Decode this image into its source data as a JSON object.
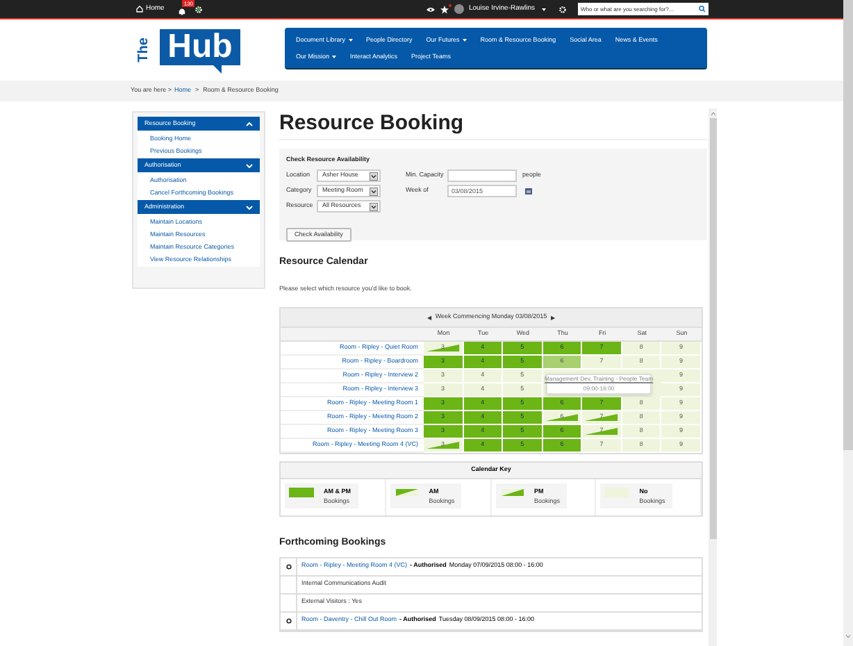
{
  "topbar": {
    "home": "Home",
    "notifications": "130",
    "user": "Louise Irvine-Rawlins",
    "search_placeholder": "Who or what are you searching for?..."
  },
  "logo": {
    "small": "The",
    "big": "Hub"
  },
  "nav": [
    {
      "label": "Document Library",
      "dropdown": true
    },
    {
      "label": "People Directory",
      "dropdown": false
    },
    {
      "label": "Our Futures",
      "dropdown": true
    },
    {
      "label": "Room & Resource Booking",
      "dropdown": false
    },
    {
      "label": "Social Area",
      "dropdown": false
    },
    {
      "label": "News & Events",
      "dropdown": false
    },
    {
      "label": "Our Mission",
      "dropdown": true
    },
    {
      "label": "Interact Analytics",
      "dropdown": false
    },
    {
      "label": "Project Teams",
      "dropdown": false
    }
  ],
  "breadcrumb": {
    "prefix": "You are here >",
    "home": "Home",
    "sep": ">",
    "current": "Room & Resource Booking"
  },
  "sidebar": [
    {
      "title": "Resource Booking",
      "expanded": true,
      "items": [
        "Booking Home",
        "Previous Bookings"
      ]
    },
    {
      "title": "Authorisation",
      "expanded": false,
      "items": [
        "Authorisation",
        "Cancel Forthcoming Bookings"
      ]
    },
    {
      "title": "Administration",
      "expanded": false,
      "items": [
        "Maintain Locations",
        "Maintain Resources",
        "Maintain Resource Categories",
        "View Resource Relationships"
      ]
    }
  ],
  "title": "Resource Booking",
  "form": {
    "heading": "Check Resource Availability",
    "selects": [
      {
        "label": "Location",
        "value": "Asher House"
      },
      {
        "label": "Category",
        "value": "Meeting Room"
      },
      {
        "label": "Resource",
        "value": "All Resources"
      }
    ],
    "capacity": {
      "label": "Min. Capacity",
      "unit": "people"
    },
    "week": {
      "label": "Week of",
      "value": "03/08/2015"
    },
    "button": "Check Availability"
  },
  "calendar": {
    "heading": "Resource Calendar",
    "intro": "Please select which resource you'd like to book.",
    "prev": "◀",
    "week": "Week Commencing Monday 03/08/2015",
    "next": "▶",
    "days": [
      "Mon",
      "Tue",
      "Wed",
      "Thu",
      "Fri",
      "Sat",
      "Sun"
    ],
    "rows": [
      {
        "resource": "Room - Ripley - Quiet Room",
        "cells": [
          {
            "kind": "pm",
            "day": "3"
          },
          {
            "kind": "full",
            "day": "4"
          },
          {
            "kind": "full",
            "day": "5"
          },
          {
            "kind": "full",
            "day": "6"
          },
          {
            "kind": "full",
            "day": "7"
          },
          {
            "kind": "none",
            "day": "8"
          },
          {
            "kind": "none",
            "day": "9"
          }
        ]
      },
      {
        "resource": "Room - Ripley - Boardroom",
        "cells": [
          {
            "kind": "full",
            "day": "3"
          },
          {
            "kind": "full",
            "day": "4"
          },
          {
            "kind": "full",
            "day": "5"
          },
          {
            "kind": "light",
            "day": "6"
          },
          {
            "kind": "none",
            "day": "7"
          },
          {
            "kind": "none",
            "day": "8"
          },
          {
            "kind": "none",
            "day": "9"
          }
        ]
      },
      {
        "resource": "Room - Ripley - Interview 2",
        "cells": [
          {
            "kind": "none",
            "day": "3"
          },
          {
            "kind": "none",
            "day": "4"
          },
          {
            "kind": "none",
            "day": "5"
          },
          {
            "kind": "covered"
          },
          {
            "kind": "covered"
          },
          {
            "kind": "covered"
          },
          {
            "kind": "none",
            "day": "9"
          }
        ]
      },
      {
        "resource": "Room - Ripley - Interview 3",
        "cells": [
          {
            "kind": "none",
            "day": "3"
          },
          {
            "kind": "none",
            "day": "4"
          },
          {
            "kind": "none",
            "day": "5"
          },
          {
            "kind": "covered"
          },
          {
            "kind": "covered"
          },
          {
            "kind": "covered"
          },
          {
            "kind": "none",
            "day": "9"
          }
        ]
      },
      {
        "resource": "Room - Ripley - Meeting Room 1",
        "cells": [
          {
            "kind": "full",
            "day": "3"
          },
          {
            "kind": "full",
            "day": "4"
          },
          {
            "kind": "full",
            "day": "5"
          },
          {
            "kind": "full",
            "day": "6"
          },
          {
            "kind": "full",
            "day": "7"
          },
          {
            "kind": "none",
            "day": "8"
          },
          {
            "kind": "none",
            "day": "9"
          }
        ]
      },
      {
        "resource": "Room - Ripley - Meeting Room 2",
        "cells": [
          {
            "kind": "full",
            "day": "3"
          },
          {
            "kind": "full",
            "day": "4"
          },
          {
            "kind": "full",
            "day": "5"
          },
          {
            "kind": "pm",
            "day": "6"
          },
          {
            "kind": "pm",
            "day": "7"
          },
          {
            "kind": "none",
            "day": "8"
          },
          {
            "kind": "none",
            "day": "9"
          }
        ]
      },
      {
        "resource": "Room - Ripley - Meeting Room 3",
        "cells": [
          {
            "kind": "full",
            "day": "3"
          },
          {
            "kind": "full",
            "day": "4"
          },
          {
            "kind": "full",
            "day": "5"
          },
          {
            "kind": "full",
            "day": "6"
          },
          {
            "kind": "pm",
            "day": "7"
          },
          {
            "kind": "none",
            "day": "8"
          },
          {
            "kind": "none",
            "day": "9"
          }
        ]
      },
      {
        "resource": "Room - Ripley - Meeting Room 4 (VC)",
        "cells": [
          {
            "kind": "pm",
            "day": "3"
          },
          {
            "kind": "full",
            "day": "4"
          },
          {
            "kind": "full",
            "day": "5"
          },
          {
            "kind": "full",
            "day": "6"
          },
          {
            "kind": "none",
            "day": "7"
          },
          {
            "kind": "none",
            "day": "8"
          },
          {
            "kind": "none",
            "day": "9"
          }
        ]
      }
    ],
    "tooltip": {
      "title": "Management Dev. Training - People Team",
      "time": "09:00-16:00"
    }
  },
  "key": {
    "heading": "Calendar Key",
    "items": [
      {
        "kind": "full",
        "title": "AM & PM",
        "sub": "Bookings"
      },
      {
        "kind": "am",
        "title": "AM",
        "sub": "Bookings"
      },
      {
        "kind": "pm",
        "title": "PM",
        "sub": "Bookings"
      },
      {
        "kind": "none",
        "title": "No",
        "sub": "Bookings"
      }
    ]
  },
  "forthcoming": {
    "heading": "Forthcoming Bookings",
    "bookings": [
      {
        "resource": "Room - Ripley - Meeting Room 4 (VC)",
        "status": "- Authorised",
        "when": "Monday 07/09/2015 08:00 - 16:00",
        "details": [
          "Internal Communications Audit",
          "External Visitors : Yes"
        ]
      },
      {
        "resource": "Room - Daventry - Chill Out Room",
        "status": "- Authorised",
        "when": "Tuesday 08/09/2015 08:00 - 16:00"
      }
    ]
  }
}
